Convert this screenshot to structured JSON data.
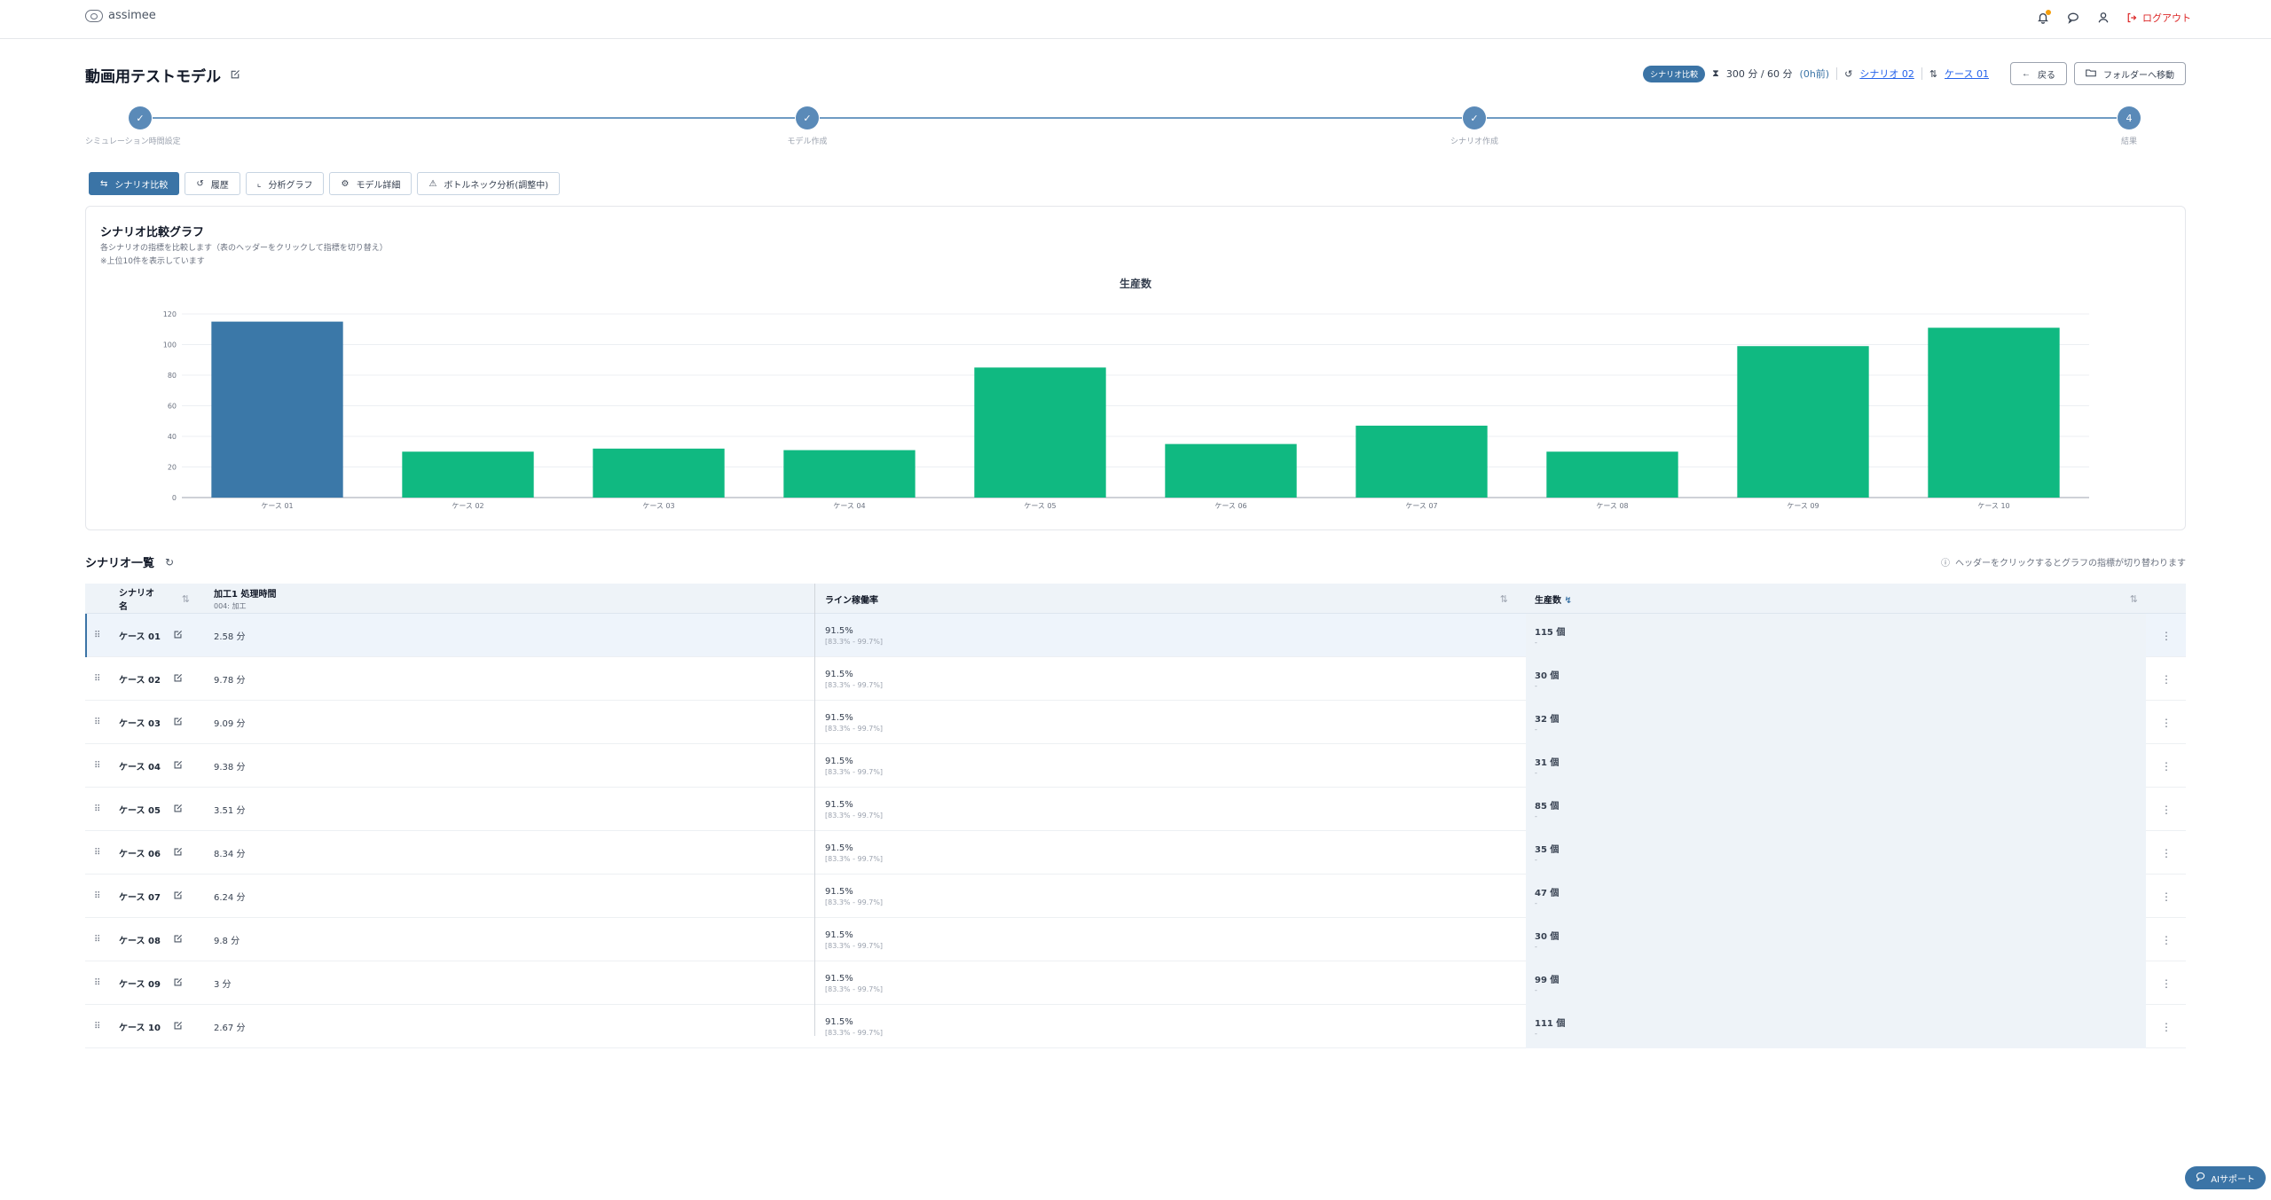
{
  "app": {
    "brand": "assimee"
  },
  "header": {
    "logout_label": "ログアウト"
  },
  "page": {
    "title": "動画用テストモデル",
    "status_pill": "シナリオ比較",
    "time_info": "300 分 / 60 分",
    "time_ago": "(0h前)",
    "scenario_link": "シナリオ 02",
    "case_link": "ケース 01",
    "back_label": "戻る",
    "folder_label": "フォルダーへ移動"
  },
  "steps": [
    {
      "label": "シミュレーション時間設定",
      "mark": "✓"
    },
    {
      "label": "モデル作成",
      "mark": "✓"
    },
    {
      "label": "シナリオ作成",
      "mark": "✓"
    },
    {
      "label": "結果",
      "mark": "4"
    }
  ],
  "tabs": [
    {
      "label": "シナリオ比較",
      "icon": "swap-icon",
      "active": true
    },
    {
      "label": "履歴",
      "icon": "history-icon",
      "active": false
    },
    {
      "label": "分析グラフ",
      "icon": "line-chart-icon",
      "active": false
    },
    {
      "label": "モデル詳細",
      "icon": "model-icon",
      "active": false
    },
    {
      "label": "ボトルネック分析(調整中)",
      "icon": "warning-icon",
      "active": false
    }
  ],
  "chart_card": {
    "title": "シナリオ比較グラフ",
    "desc1": "各シナリオの指標を比較します（表のヘッダーをクリックして指標を切り替え）",
    "desc2": "※上位10件を表示しています"
  },
  "chart_data": {
    "type": "bar",
    "title": "生産数",
    "categories": [
      "ケース 01",
      "ケース 02",
      "ケース 03",
      "ケース 04",
      "ケース 05",
      "ケース 06",
      "ケース 07",
      "ケース 08",
      "ケース 09",
      "ケース 10"
    ],
    "values": [
      115,
      30,
      32,
      31,
      85,
      35,
      47,
      30,
      99,
      111
    ],
    "ylim": [
      0,
      120
    ],
    "yticks": [
      0,
      20,
      40,
      60,
      80,
      100,
      120
    ],
    "grid": true,
    "colors": {
      "highlight": "#3b78a8",
      "default": "#10b981"
    },
    "highlight_index": 0
  },
  "table": {
    "section_title": "シナリオ一覧",
    "hint": "ヘッダーをクリックするとグラフの指標が切り替わります",
    "headers": {
      "name": "シナリオ名",
      "proc": "加工1 処理時間",
      "proc_sub": "004: 加工",
      "rate": "ライン稼働率",
      "prod": "生産数"
    },
    "rows": [
      {
        "name": "ケース 01",
        "proc": "2.58 分",
        "rate": "91.5%",
        "range": "[83.3% - 99.7%]",
        "prod": "115 個",
        "prod_sub": "-"
      },
      {
        "name": "ケース 02",
        "proc": "9.78 分",
        "rate": "91.5%",
        "range": "[83.3% - 99.7%]",
        "prod": "30 個",
        "prod_sub": "-"
      },
      {
        "name": "ケース 03",
        "proc": "9.09 分",
        "rate": "91.5%",
        "range": "[83.3% - 99.7%]",
        "prod": "32 個",
        "prod_sub": "-"
      },
      {
        "name": "ケース 04",
        "proc": "9.38 分",
        "rate": "91.5%",
        "range": "[83.3% - 99.7%]",
        "prod": "31 個",
        "prod_sub": "-"
      },
      {
        "name": "ケース 05",
        "proc": "3.51 分",
        "rate": "91.5%",
        "range": "[83.3% - 99.7%]",
        "prod": "85 個",
        "prod_sub": "-"
      },
      {
        "name": "ケース 06",
        "proc": "8.34 分",
        "rate": "91.5%",
        "range": "[83.3% - 99.7%]",
        "prod": "35 個",
        "prod_sub": "-"
      },
      {
        "name": "ケース 07",
        "proc": "6.24 分",
        "rate": "91.5%",
        "range": "[83.3% - 99.7%]",
        "prod": "47 個",
        "prod_sub": "-"
      },
      {
        "name": "ケース 08",
        "proc": "9.8 分",
        "rate": "91.5%",
        "range": "[83.3% - 99.7%]",
        "prod": "30 個",
        "prod_sub": "-"
      },
      {
        "name": "ケース 09",
        "proc": "3 分",
        "rate": "91.5%",
        "range": "[83.3% - 99.7%]",
        "prod": "99 個",
        "prod_sub": "-"
      },
      {
        "name": "ケース 10",
        "proc": "2.67 分",
        "rate": "91.5%",
        "range": "[83.3% - 99.7%]",
        "prod": "111 個",
        "prod_sub": "-"
      }
    ]
  },
  "ai_support_label": "AIサポート"
}
